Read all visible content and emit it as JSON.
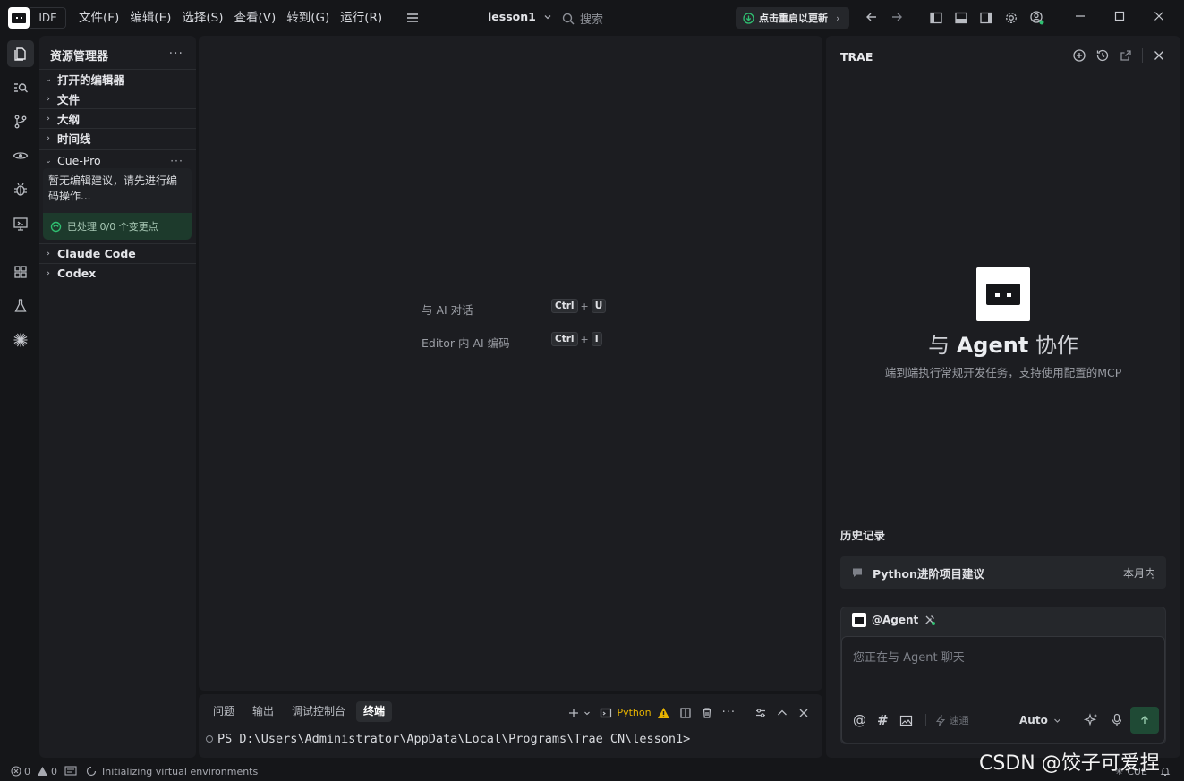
{
  "titlebar": {
    "ide_label": "IDE",
    "menu": [
      "文件(F)",
      "编辑(E)",
      "选择(S)",
      "查看(V)",
      "转到(G)",
      "运行(R)"
    ],
    "project": "lesson1",
    "search_label": "搜索",
    "update_label": "点击重启以更新"
  },
  "sidebar": {
    "title": "资源管理器",
    "sections": [
      "打开的编辑器",
      "文件",
      "大纲",
      "时间线"
    ],
    "cue": {
      "title": "Cue-Pro",
      "message": "暂无编辑建议，请先进行编码操作...",
      "status": "已处理 0/0 个变更点"
    },
    "sections_after": [
      "Claude Code",
      "Codex"
    ]
  },
  "editor": {
    "hints": [
      {
        "label": "与 AI 对话",
        "keys": [
          "Ctrl",
          "U"
        ]
      },
      {
        "label": "Editor 内 AI 编码",
        "keys": [
          "Ctrl",
          "I"
        ]
      }
    ]
  },
  "panel": {
    "tabs": [
      "问题",
      "输出",
      "调试控制台",
      "终端"
    ],
    "active_tab": "终端",
    "terminal_profile": "Python",
    "prompt": "PS D:\\Users\\Administrator\\AppData\\Local\\Programs\\Trae CN\\lesson1>"
  },
  "chat": {
    "title": "TRAE",
    "headline_prefix": "与",
    "headline_bold": "Agent",
    "headline_suffix": "协作",
    "subtitle": "端到端执行常规开发任务，支持使用配置的MCP",
    "history_title": "历史记录",
    "history": [
      {
        "title": "Python进阶项目建议",
        "when": "本月内"
      }
    ],
    "agent": "@Agent",
    "input_placeholder": "您正在与 Agent 聊天",
    "speed_label": "速通",
    "model": "Auto"
  },
  "statusbar": {
    "errors": "0",
    "warnings": "0",
    "message": "Initializing virtual environments",
    "right_label": "CUE"
  },
  "watermark": "CSDN @饺子可爱捏",
  "colors": {
    "accent_green": "#2fbf71",
    "warning": "#e8b400",
    "bg": "#151619",
    "panel": "#1c1d21"
  }
}
